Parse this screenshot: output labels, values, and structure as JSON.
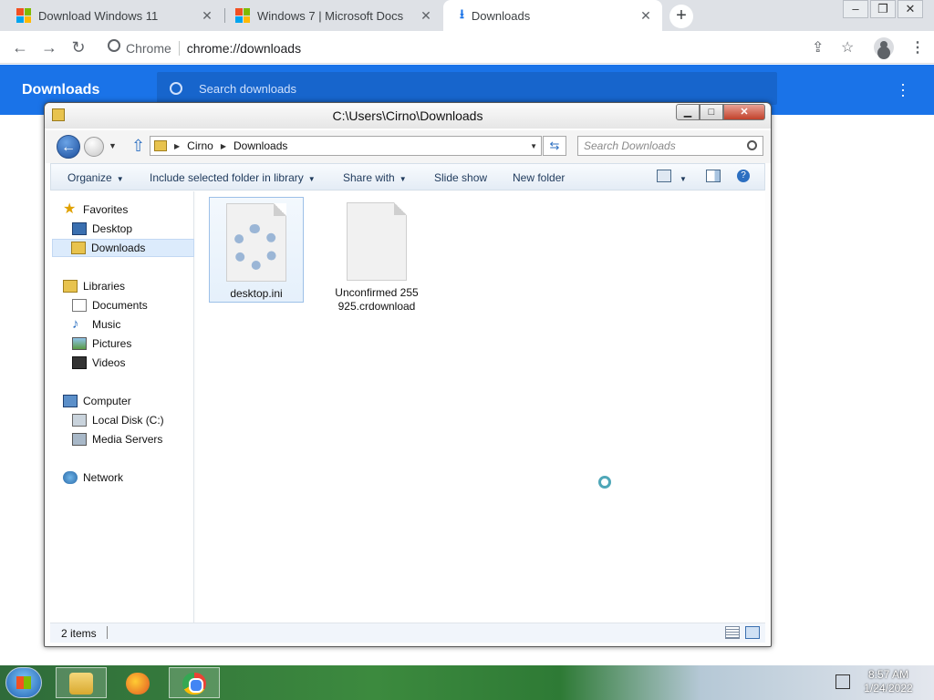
{
  "browser": {
    "tabs": [
      {
        "title": "Download Windows 11",
        "icon": "microsoft-logo"
      },
      {
        "title": "Windows 7 | Microsoft Docs",
        "icon": "microsoft-logo"
      },
      {
        "title": "Downloads",
        "icon": "download-icon",
        "active": true
      }
    ],
    "new_tab": "+",
    "omnibox": {
      "site": "Chrome",
      "url": "chrome://downloads"
    },
    "page_title": "Downloads",
    "search_placeholder": "Search downloads"
  },
  "explorer": {
    "title": "C:\\Users\\Cirno\\Downloads",
    "breadcrumb": [
      "Cirno",
      "Downloads"
    ],
    "search_placeholder": "Search Downloads",
    "commands": {
      "organize": "Organize",
      "include": "Include selected folder in library",
      "share": "Share with",
      "slideshow": "Slide show",
      "new_folder": "New folder"
    },
    "nav": {
      "favorites": "Favorites",
      "desktop": "Desktop",
      "downloads": "Downloads",
      "libraries": "Libraries",
      "documents": "Documents",
      "music": "Music",
      "pictures": "Pictures",
      "videos": "Videos",
      "computer": "Computer",
      "local_disk": "Local Disk (C:)",
      "media_servers": "Media Servers",
      "network": "Network"
    },
    "files": [
      {
        "name": "desktop.ini",
        "type": "settings-file",
        "selected": true
      },
      {
        "name": "Unconfirmed 255925.crdownload",
        "type": "blank-file",
        "selected": false
      }
    ],
    "status": "2 items"
  },
  "taskbar": {
    "apps": [
      "windows-explorer",
      "firefox",
      "chrome"
    ],
    "time": "8:57 AM",
    "date": "1/24/2022"
  },
  "colors": {
    "chrome_blue": "#1a73e8",
    "win7_selection": "#dcebfc"
  }
}
